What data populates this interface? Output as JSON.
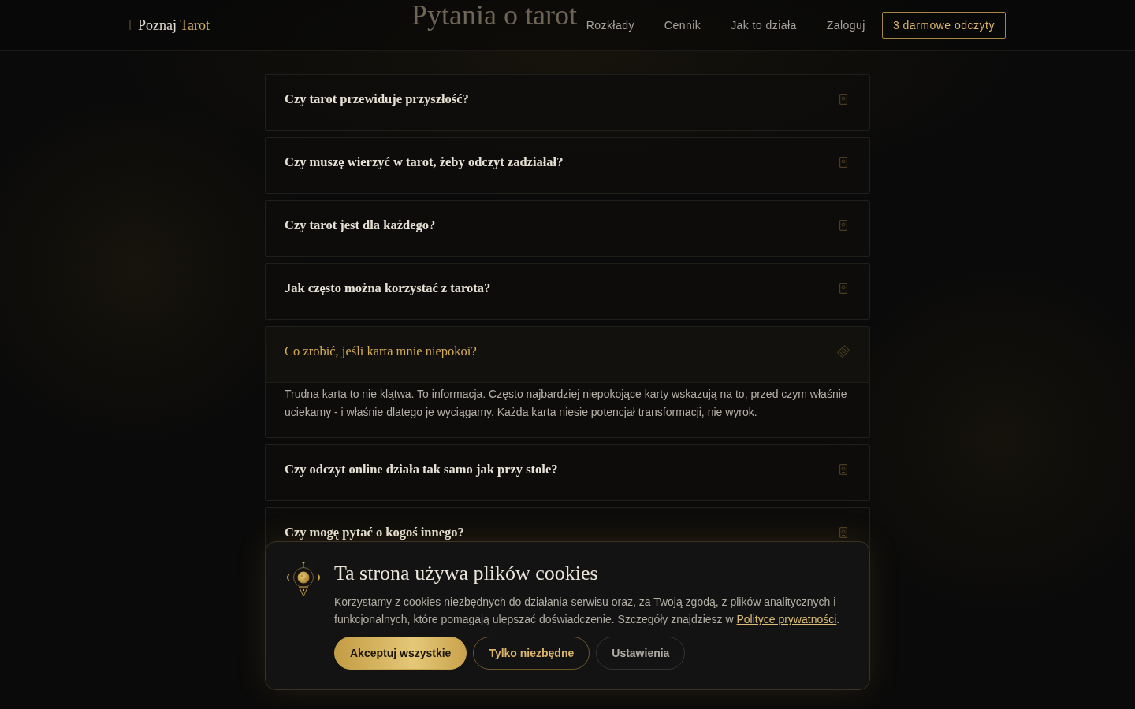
{
  "header": {
    "logo": {
      "text": "Poznaj",
      "accent": "Tarot"
    },
    "nav": [
      "Rozkłady",
      "Cennik",
      "Jak to działa",
      "Zaloguj"
    ],
    "cta": "3 darmowe odczyty"
  },
  "section_title": "Pytania o tarot",
  "faq": [
    {
      "question": "Czy tarot przewiduje przyszłość?",
      "expanded": false
    },
    {
      "question": "Czy muszę wierzyć w tarot, żeby odczyt zadziałał?",
      "expanded": false
    },
    {
      "question": "Czy tarot jest dla każdego?",
      "expanded": false
    },
    {
      "question": "Jak często można korzystać z tarota?",
      "expanded": false
    },
    {
      "question": "Co zrobić, jeśli karta mnie niepokoi?",
      "expanded": true,
      "answer": "Trudna karta to nie klątwa. To informacja. Często najbardziej niepokojące karty wskazują na to, przed czym właśnie uciekamy - i właśnie dlatego je wyciągamy. Każda karta niesie potencjał transformacji, nie wyrok."
    },
    {
      "question": "Czy odczyt online działa tak samo jak przy stole?",
      "expanded": false
    },
    {
      "question": "Czy mogę pytać o kogoś innego?",
      "expanded": false
    }
  ],
  "cookie_banner": {
    "title": "Ta strona używa plików cookies",
    "text": "Korzystamy z cookies niezbędnych do działania serwisu oraz, za Twoją zgodą, z plików analitycznych i funkcjonalnych, które pomagają ulepszać doświadczenie. Szczegóły znajdziesz w",
    "link": "Polityce prywatności",
    "text_end": ".",
    "buttons": [
      {
        "label": "Akceptuj wszystkie",
        "kind": "primary"
      },
      {
        "label": "Tylko niezbędne",
        "kind": "outline"
      },
      {
        "label": "Ustawienia",
        "kind": "secondary"
      }
    ]
  }
}
